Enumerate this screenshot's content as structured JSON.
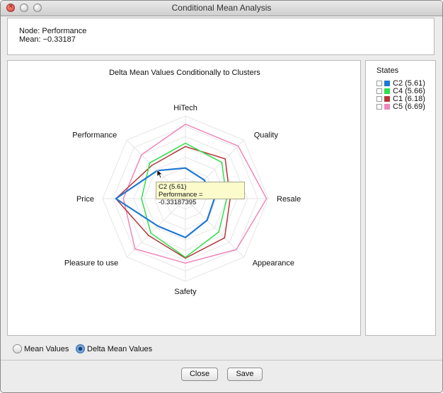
{
  "window": {
    "title": "Conditional Mean Analysis"
  },
  "info": {
    "node_line": "Node: Performance",
    "mean_line": "Mean: −0.33187"
  },
  "legend": {
    "title": "States",
    "items": [
      {
        "label": "C2 (5.61)",
        "color": "#1f78d1"
      },
      {
        "label": "C4 (5.66)",
        "color": "#2ee04a"
      },
      {
        "label": "C1 (6.18)",
        "color": "#b3363a"
      },
      {
        "label": "C5 (6.69)",
        "color": "#ee88bb"
      }
    ]
  },
  "chart_data": {
    "type": "radar",
    "title": "Delta Mean Values Conditionally to Clusters",
    "axes": [
      "HiTech",
      "Quality",
      "Resale",
      "Appearance",
      "Safety",
      "Pleasure to use",
      "Price",
      "Performance"
    ],
    "range": [
      0,
      1
    ],
    "grid_rings": 8,
    "series": [
      {
        "name": "C2 (5.61)",
        "color": "#1f78d1",
        "values": [
          0.37,
          0.32,
          0.35,
          0.37,
          0.47,
          0.47,
          0.84,
          0.48
        ]
      },
      {
        "name": "C4 (5.66)",
        "color": "#2ee04a",
        "values": [
          0.67,
          0.62,
          0.5,
          0.57,
          0.71,
          0.59,
          0.53,
          0.61
        ]
      },
      {
        "name": "C1 (6.18)",
        "color": "#b3363a",
        "values": [
          0.63,
          0.68,
          0.54,
          0.67,
          0.72,
          0.63,
          0.84,
          0.57
        ]
      },
      {
        "name": "C5 (6.69)",
        "color": "#ee88bb",
        "values": [
          0.9,
          0.9,
          0.98,
          0.87,
          0.78,
          0.86,
          0.75,
          0.75
        ]
      }
    ]
  },
  "tooltip": {
    "line1": "C2 (5.61)",
    "line2": "Performance = -0.33187395"
  },
  "controls": {
    "radio_mean": "Mean Values",
    "radio_delta": "Delta Mean Values",
    "selected": "Delta Mean Values",
    "close_label": "Close",
    "save_label": "Save"
  }
}
